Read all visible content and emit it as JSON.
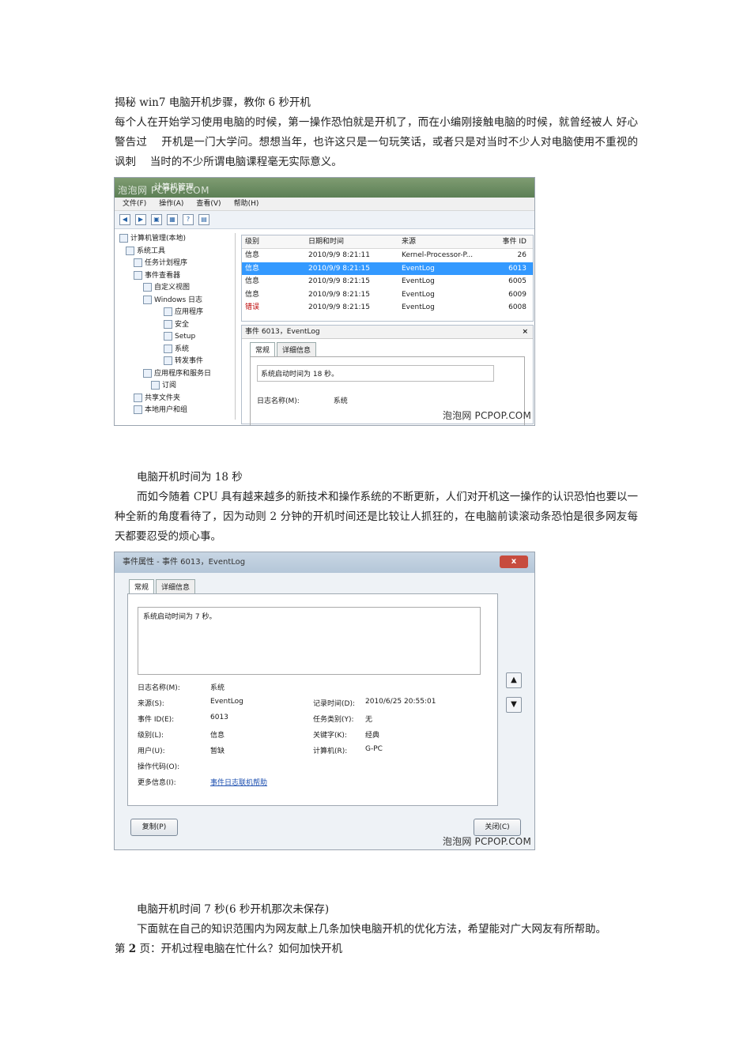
{
  "title": "揭秘 win7 电脑开机步骤，教你 6 秒开机",
  "intro": "每个人在开始学习使用电脑的时候，第一操作恐怕就是开机了，而在小编刚接触电脑的时候，就曾经被人 好心 警告过 　开机是一门大学问。想想当年，也许这只是一句玩笑话，或者只是对当时不少人对电脑使用不重视的讽刺 　当时的不少所谓电脑课程毫无实际意义。",
  "caption1": "电脑开机时间为 18 秒",
  "para2": "而如今随着 CPU 具有越来越多的新技术和操作系统的不断更新，人们对开机这一操作的认识恐怕也要以一种全新的角度看待了，因为动则 2 分钟的开机时间还是比较让人抓狂的，在电脑前读滚动条恐怕是很多网友每天都要忍受的烦心事。",
  "caption2": "电脑开机时间 7 秒(6 秒开机那次未保存)",
  "para3": "下面就在自己的知识范围内为网友献上几条加快电脑开机的优化方法，希望能对广大网友有所帮助。",
  "page_prefix": "第",
  "page_num": "2",
  "page_suffix": "页：开机过程电脑在忙什么？如何加快开机",
  "shot1": {
    "watermark_top": "泡泡网 PCPOP.COM",
    "window_title": "计算机管理",
    "menu": [
      "文件(F)",
      "操作(A)",
      "查看(V)",
      "帮助(H)"
    ],
    "tree": [
      "计算机管理(本地)",
      "系统工具",
      "任务计划程序",
      "事件查看器",
      "自定义视图",
      "Windows 日志",
      "应用程序",
      "安全",
      "Setup",
      "系统",
      "转发事件",
      "应用程序和服务日",
      "订阅",
      "共享文件夹",
      "本地用户和组"
    ],
    "columns": [
      "级别",
      "日期和时间",
      "来源",
      "事件 ID"
    ],
    "rows": [
      [
        "信息",
        "2010/9/9 8:21:11",
        "Kernel-Processor-P...",
        "26"
      ],
      [
        "信息",
        "2010/9/9 8:21:15",
        "EventLog",
        "6013"
      ],
      [
        "信息",
        "2010/9/9 8:21:15",
        "EventLog",
        "6005"
      ],
      [
        "信息",
        "2010/9/9 8:21:15",
        "EventLog",
        "6009"
      ],
      [
        "错误",
        "2010/9/9 8:21:15",
        "EventLog",
        "6008"
      ]
    ],
    "detail_title": "事件 6013，EventLog",
    "tab1": "常规",
    "tab2": "详细信息",
    "detail_text": "系统启动时间为 18 秒。",
    "log_label": "日志名称(M):",
    "log_value": "系统",
    "watermark": "泡泡网 PCPOP.COM"
  },
  "shot2": {
    "window_title": "事件属性 - 事件 6013，EventLog",
    "close_x": "x",
    "tab1": "常规",
    "tab2": "详细信息",
    "text": "系统启动时间为 7 秒。",
    "left_fields": [
      {
        "label": "日志名称(M):",
        "value": "系统"
      },
      {
        "label": "来源(S):",
        "value": "EventLog"
      },
      {
        "label": "事件 ID(E):",
        "value": "6013"
      },
      {
        "label": "级别(L):",
        "value": "信息"
      },
      {
        "label": "用户(U):",
        "value": "暂缺"
      },
      {
        "label": "操作代码(O):",
        "value": ""
      },
      {
        "label": "更多信息(I):",
        "value": "事件日志联机帮助"
      }
    ],
    "right_fields": [
      {
        "label": "记录时间(D):",
        "value": "2010/6/25 20:55:01"
      },
      {
        "label": "任务类别(Y):",
        "value": "无"
      },
      {
        "label": "关键字(K):",
        "value": "经典"
      },
      {
        "label": "计算机(R):",
        "value": "G-PC"
      }
    ],
    "copy_button": "复制(P)",
    "close_button": "关闭(C)",
    "watermark": "泡泡网 PCPOP.COM"
  }
}
